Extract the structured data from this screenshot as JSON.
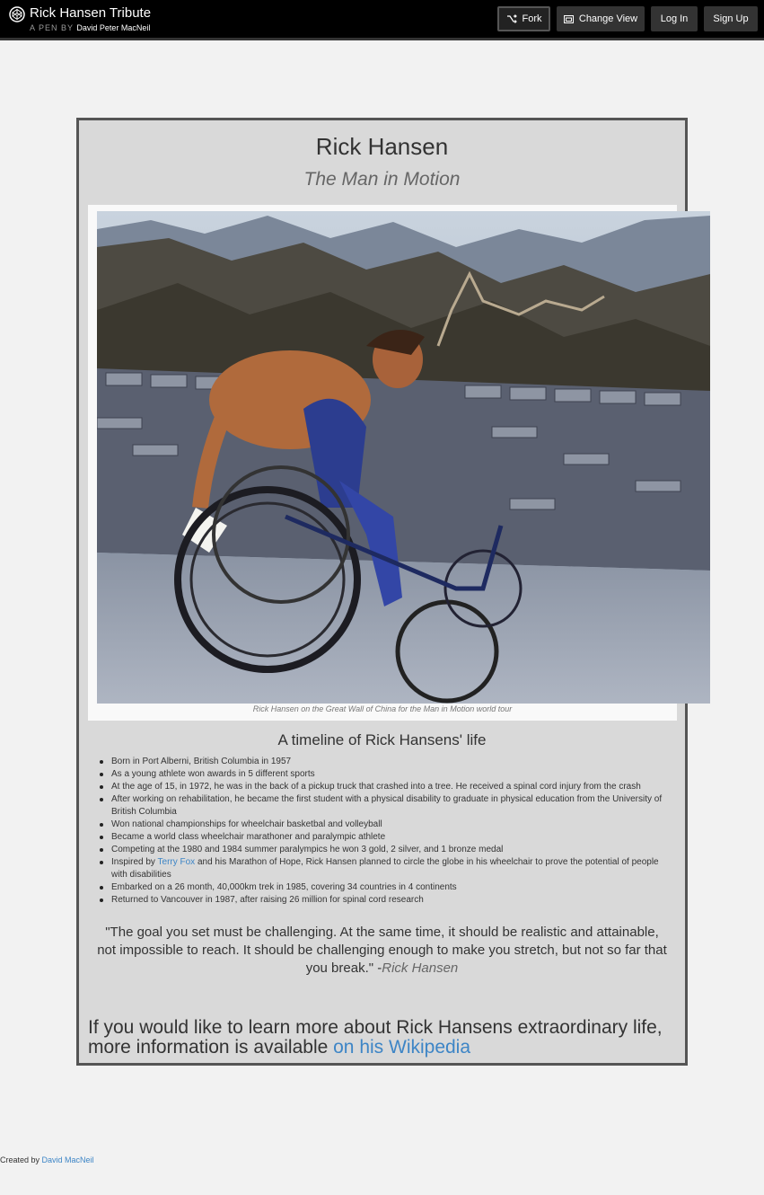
{
  "topbar": {
    "pen_title": "Rick Hansen Tribute",
    "pen_by_label": "A PEN BY",
    "author": "David Peter MacNeil",
    "logo_icon": "codepen-logo-icon",
    "buttons": {
      "fork": "Fork",
      "change_view": "Change View",
      "login": "Log In",
      "signup": "Sign Up"
    }
  },
  "main": {
    "title": "Rick Hansen",
    "subtitle": "The Man in Motion",
    "image_caption": "Rick Hansen on the Great Wall of China for the Man in Motion world tour",
    "timeline_heading": "A timeline of Rick Hansens' life",
    "timeline": [
      {
        "text": "Born in Port Alberni, British Columbia in 1957"
      },
      {
        "text": "As a young athlete won awards in 5 different sports"
      },
      {
        "text": "At the age of 15, in 1972, he was in the back of a pickup truck that crashed into a tree. He received a spinal cord injury from the crash"
      },
      {
        "text": "After working on rehabilitation, he became the first student with a physical disability to graduate in physical education from the University of British Columbia"
      },
      {
        "text": "Won national championships for wheelchair basketbal and volleyball"
      },
      {
        "text": "Became a world class wheelchair marathoner and paralympic athlete"
      },
      {
        "text": "Competing at the 1980 and 1984 summer paralympics he won 3 gold, 2 silver, and 1 bronze medal"
      },
      {
        "before": "Inspired by ",
        "link": "Terry Fox",
        "after": " and his Marathon of Hope, Rick Hansen planned to circle the globe in his wheelchair to prove the potential of people with disabilities"
      },
      {
        "text": "Embarked on a 26 month, 40,000km trek in 1985, covering 34 countries in 4 continents"
      },
      {
        "text": "Returned to Vancouver in 1987, after raising 26 million for spinal cord research"
      }
    ],
    "quote_text": "\"The goal you set must be challenging. At the same time, it should be realistic and attainable, not impossible to reach. It should be challenging enough to make you stretch, but not so far that you break.\" -",
    "quote_author": "Rick Hansen",
    "more_info_text": "If you would like to learn more about Rick Hansens extraordinary life, more information is available ",
    "more_info_link": "on his Wikipedia"
  },
  "footer": {
    "created_by": "Created by ",
    "author_link": "David MacNeil"
  },
  "colors": {
    "link": "#3d85c6",
    "card_bg": "#d9d9d9",
    "card_border": "#555555",
    "page_bg": "#f2f2f2",
    "topbar_bg": "#000000"
  }
}
